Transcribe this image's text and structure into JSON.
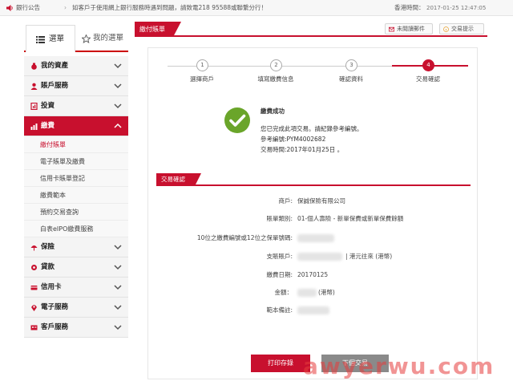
{
  "topbar": {
    "label": "銀行公告",
    "separator": "›",
    "text": "如客戶于使用網上銀行服務時遇到問題，請致電218 95588或聯繫分行！",
    "time_label": "香港時間：",
    "time_value": "2017-01-25 12:47:05"
  },
  "sidebar": {
    "tabs": [
      {
        "label": "選單"
      },
      {
        "label": "我的選單"
      }
    ],
    "items": [
      {
        "label": "我的資產"
      },
      {
        "label": "賬戶服務"
      },
      {
        "label": "投資"
      },
      {
        "label": "繳費"
      },
      {
        "label": "保險"
      },
      {
        "label": "貸款"
      },
      {
        "label": "信用卡"
      },
      {
        "label": "電子服務"
      },
      {
        "label": "客戶服務"
      }
    ],
    "subitems": [
      {
        "label": "繳付賬單"
      },
      {
        "label": "電子賬單及繳費"
      },
      {
        "label": "信用卡賬單登記"
      },
      {
        "label": "繳費範本"
      },
      {
        "label": "預約交易查詢"
      },
      {
        "label": "白表eIPO繳費服務"
      }
    ]
  },
  "main": {
    "tab_label": "繳付賬單",
    "chip_unread": "未閱讀郵件",
    "chip_help": "交易提示",
    "steps": [
      {
        "num": "1",
        "label": "選擇商戶"
      },
      {
        "num": "2",
        "label": "填寫繳費信息"
      },
      {
        "num": "3",
        "label": "確認資料"
      },
      {
        "num": "4",
        "label": "交易確認"
      }
    ],
    "success": {
      "title": "繳費成功",
      "line1": "您已完成此項交易。請紀錄參考編號。",
      "line2": "參考編號:PYM4002682",
      "line3": "交易時間:2017年01月25日 。"
    },
    "section_title": "交易確認",
    "fields": {
      "merchant_label": "商戶:",
      "merchant_value": "保誠保險有限公司",
      "billtype_label": "賬單類別:",
      "billtype_value": "01-個人壽險 - 新單保費或新單保費餘額",
      "policy_label": "10位之繳費編號或12位之保單號碼:",
      "account_label": "支賬賬戶:",
      "account_value": "| 港元往來 (港幣)",
      "date_label": "繳費日期:",
      "date_value": "20170125",
      "amount_label": "金額：",
      "amount_value": "(港幣)",
      "remark_label": "範本備註:"
    },
    "buttons": {
      "print": "打印存錄",
      "next": "下個交易"
    }
  },
  "watermark": "awyerwu.com",
  "colors": {
    "accent": "#c8102e",
    "success": "#6aa52a",
    "grey_button": "#8a8a8a"
  }
}
